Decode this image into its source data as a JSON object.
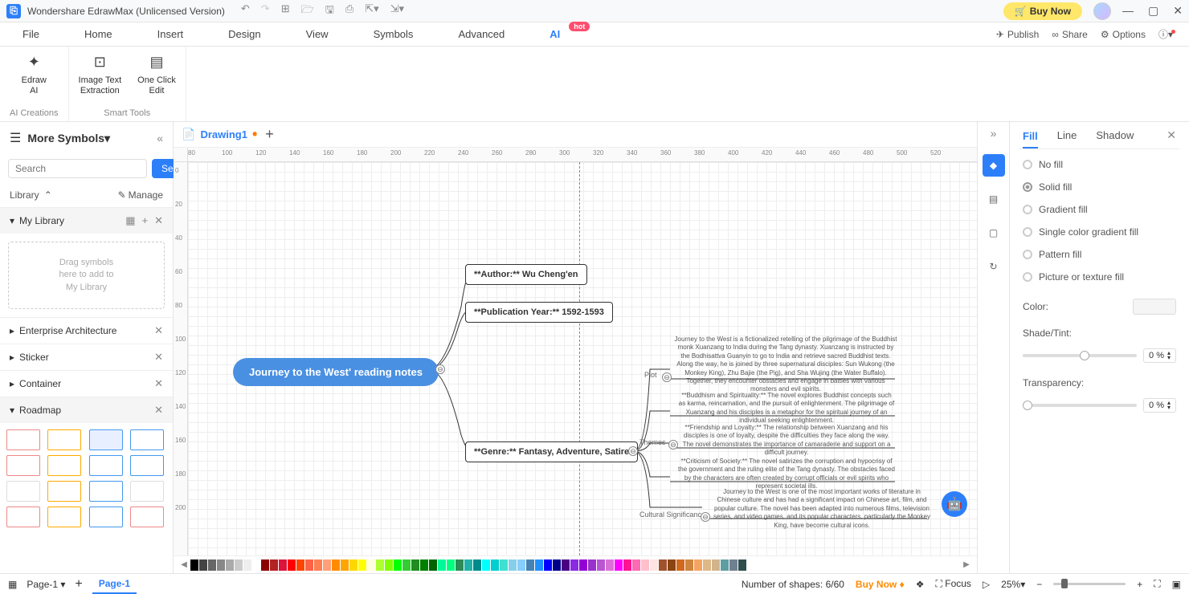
{
  "titlebar": {
    "app_name": "Wondershare EdrawMax (Unlicensed Version)",
    "buy_now": "Buy Now"
  },
  "menubar": {
    "items": [
      "File",
      "Home",
      "Insert",
      "Design",
      "View",
      "Symbols",
      "Advanced",
      "AI"
    ],
    "hot": "hot",
    "publish": "Publish",
    "share": "Share",
    "options": "Options"
  },
  "ribbon": {
    "edraw_ai": "Edraw\nAI",
    "image_text": "Image Text\nExtraction",
    "one_click": "One Click\nEdit",
    "group1": "AI Creations",
    "group2": "Smart Tools"
  },
  "sidebar": {
    "title": "More Symbols",
    "search_placeholder": "Search",
    "search_btn": "Search",
    "library": "Library",
    "manage": "Manage",
    "my_library": "My Library",
    "drop_zone": "Drag symbols\nhere to add to\nMy Library",
    "sections": [
      "Enterprise Architecture",
      "Sticker",
      "Container",
      "Roadmap"
    ]
  },
  "tabs": {
    "drawing1": "Drawing1"
  },
  "ruler_h": [
    "80",
    "100",
    "120",
    "140",
    "160",
    "180",
    "200",
    "220",
    "240",
    "260",
    "280",
    "300",
    "320",
    "340",
    "360",
    "380",
    "400",
    "420",
    "440",
    "460",
    "480",
    "500",
    "520"
  ],
  "ruler_v": [
    "0",
    "20",
    "40",
    "60",
    "80",
    "100",
    "120",
    "140",
    "160",
    "180",
    "200"
  ],
  "mindmap": {
    "root": "Journey to the West' reading notes",
    "author": "**Author:** Wu Cheng'en",
    "pub_year": "**Publication Year:** 1592-1593",
    "genre": "**Genre:** Fantasy, Adventure, Satire",
    "plot_label": "Plot",
    "themes_label": "Themes",
    "sig_label": "Cultural Significance",
    "plot_text": "Journey to the West is a fictionalized retelling of the pilgrimage of the Buddhist monk Xuanzang to India during the Tang dynasty. Xuanzang is instructed by the Bodhisattva Guanyin to go to India and retrieve sacred Buddhist texts. Along the way, he is joined by three supernatural disciples: Sun Wukong (the Monkey King), Zhu Bajie (the Pig), and Sha Wujing (the Water Buffalo). Together, they encounter obstacles and engage in battles with various monsters and evil spirits.",
    "theme1": "**Buddhism and Spirituality:** The novel explores Buddhist concepts such as karma, reincarnation, and the pursuit of enlightenment. The pilgrimage of Xuanzang and his disciples is a metaphor for the spiritual journey of an individual seeking enlightenment.",
    "theme2": "**Friendship and Loyalty:** The relationship between Xuanzang and his disciples is one of loyalty, despite the difficulties they face along the way. The novel demonstrates the importance of camaraderie and support on a difficult journey.",
    "theme3": "**Criticism of Society:** The novel satirizes the corruption and hypocrisy of the government and the ruling elite of the Tang dynasty. The obstacles faced by the characters are often created by corrupt officials or evil spirits who represent societal ills.",
    "sig_text": "Journey to the West is one of the most important works of literature in Chinese culture and has had a significant impact on Chinese art, film, and popular culture. The novel has been adapted into numerous films, television series, and video games, and its popular characters, particularly the Monkey King, have become cultural icons."
  },
  "right_panel": {
    "tabs": [
      "Fill",
      "Line",
      "Shadow"
    ],
    "fill_options": [
      "No fill",
      "Solid fill",
      "Gradient fill",
      "Single color gradient fill",
      "Pattern fill",
      "Picture or texture fill"
    ],
    "color_label": "Color:",
    "shade_label": "Shade/Tint:",
    "transparency_label": "Transparency:",
    "zero_pct": "0 %"
  },
  "statusbar": {
    "page_dropdown": "Page-1",
    "page_tab": "Page-1",
    "shapes": "Number of shapes: 6/60",
    "buy_now": "Buy Now",
    "focus": "Focus",
    "zoom": "25%"
  },
  "colors": [
    "#000",
    "#444",
    "#666",
    "#888",
    "#aaa",
    "#ccc",
    "#eee",
    "#fff",
    "#8b0000",
    "#b22222",
    "#dc143c",
    "#ff0000",
    "#ff4500",
    "#ff6347",
    "#ff7f50",
    "#ffa07a",
    "#ff8c00",
    "#ffa500",
    "#ffd700",
    "#ffff00",
    "#ffffe0",
    "#adff2f",
    "#7fff00",
    "#00ff00",
    "#32cd32",
    "#228b22",
    "#008000",
    "#006400",
    "#00fa9a",
    "#00ff7f",
    "#2e8b57",
    "#20b2aa",
    "#008b8b",
    "#00ffff",
    "#00ced1",
    "#40e0d0",
    "#87ceeb",
    "#87cefa",
    "#4682b4",
    "#1e90ff",
    "#0000ff",
    "#00008b",
    "#4b0082",
    "#8a2be2",
    "#9400d3",
    "#9932cc",
    "#ba55d3",
    "#da70d6",
    "#ff00ff",
    "#ff1493",
    "#ff69b4",
    "#ffc0cb",
    "#ffe4e1",
    "#a0522d",
    "#8b4513",
    "#d2691e",
    "#cd853f",
    "#f4a460",
    "#deb887",
    "#d2b48c",
    "#5f9ea0",
    "#708090",
    "#2f4f4f"
  ]
}
